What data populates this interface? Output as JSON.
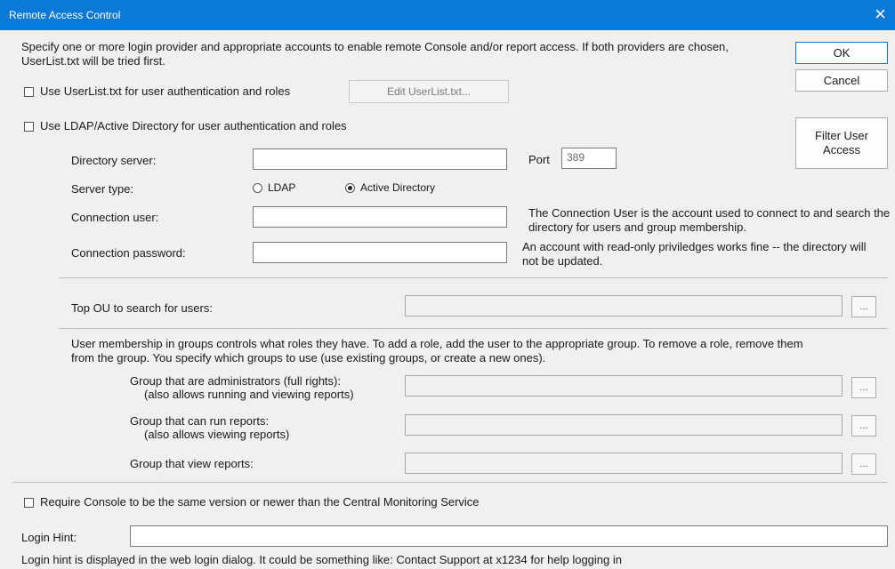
{
  "window": {
    "title": "Remote Access Control",
    "close_glyph": "×"
  },
  "intro_text": "Specify one or more login provider and appropriate accounts to enable remote Console and/or report access.  If both providers are chosen, UserList.txt will be tried first.",
  "buttons": {
    "ok": "OK",
    "cancel": "Cancel",
    "filter_user_access": "Filter User Access",
    "edit_userlist": "Edit UserList.txt...",
    "browse": "..."
  },
  "options": {
    "use_userlist": {
      "label": "Use UserList.txt for user authentication and roles",
      "checked": false
    },
    "use_ldap": {
      "label": "Use LDAP/Active Directory for user authentication and roles",
      "checked": false
    },
    "require_console_version": {
      "label": "Require Console to be the same version or newer than the Central Monitoring Service",
      "checked": false
    }
  },
  "ldap": {
    "directory_server_label": "Directory server:",
    "directory_server_value": "",
    "port_label": "Port",
    "port_value": "389",
    "server_type_label": "Server type:",
    "server_type_options": [
      "LDAP",
      "Active Directory"
    ],
    "server_type_selected": "Active Directory",
    "connection_user_label": "Connection user:",
    "connection_user_value": "",
    "connection_password_label": "Connection password:",
    "connection_password_value": "",
    "connection_note_1": "The Connection User is the account used to connect to and search the directory for users and group membership.",
    "connection_note_2": "An account with read-only priviledges works fine -- the directory will not be updated.",
    "top_ou_label": "Top OU to search for users:",
    "top_ou_value": "",
    "groups_description": "User membership in groups controls what roles they have. To add a role, add the user to the appropriate group. To remove a role, remove them from the group.  You specify which groups to use (use existing groups, or create a new ones).",
    "admin_group_label_1": "Group that are administrators (full rights):",
    "admin_group_label_2": "(also allows running and viewing reports)",
    "admin_group_value": "",
    "run_group_label_1": "Group that can run reports:",
    "run_group_label_2": "(also allows viewing reports)",
    "run_group_value": "",
    "view_group_label": "Group that view reports:",
    "view_group_value": ""
  },
  "login_hint": {
    "label": "Login Hint:",
    "value": "",
    "description": "Login hint is displayed in the web login dialog.  It could be something like: Contact Support at x1234 for help logging in"
  }
}
